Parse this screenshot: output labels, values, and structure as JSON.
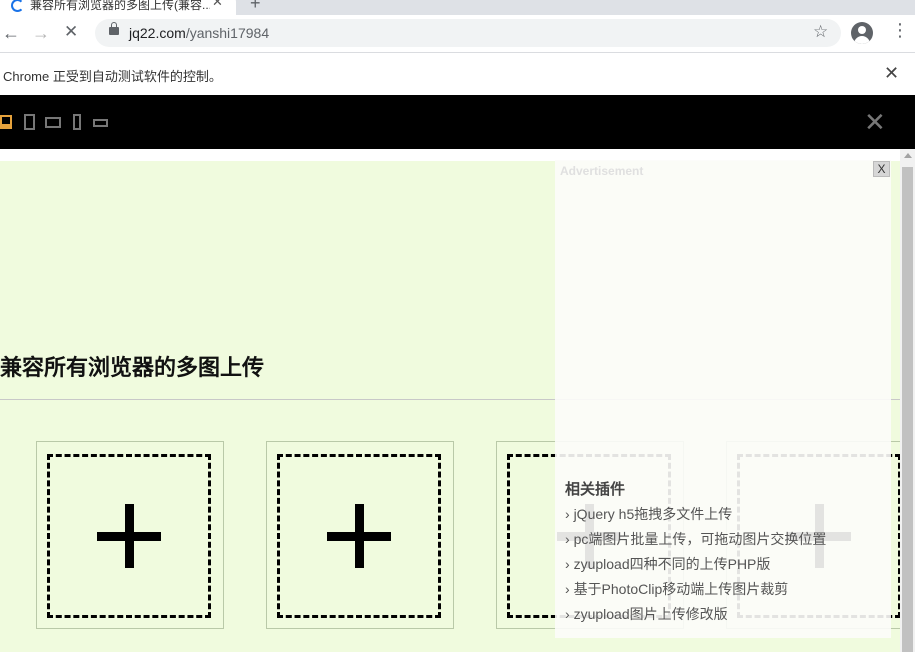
{
  "browser": {
    "tab_title": "兼容所有浏览器的多图上传(兼容...",
    "url_domain": "jq22.com",
    "url_path": "/yanshi17984",
    "infobar_text": "Chrome 正受到自动测试软件的控制。",
    "icons": {
      "back": "back-arrow-icon",
      "forward": "forward-arrow-icon",
      "stop": "close-icon",
      "star": "star-icon",
      "account": "account-icon",
      "menu": "more-vert-icon"
    }
  },
  "devbar": {
    "devices": [
      "desktop-icon",
      "tablet-portrait-icon",
      "tablet-landscape-icon",
      "phone-portrait-icon",
      "phone-landscape-icon"
    ],
    "close": "close-icon"
  },
  "page": {
    "heading": "兼容所有浏览器的多图上传",
    "upload_slots": 4,
    "background_color": "#f0fbde"
  },
  "ad": {
    "label": "Advertisement",
    "close_label": "X",
    "related_title": "相关插件",
    "related_items": [
      "jQuery h5拖拽多文件上传",
      "pc端图片批量上传，可拖动图片交换位置",
      "zyupload四种不同的上传PHP版",
      "基于PhotoClip移动端上传图片裁剪",
      "zyupload图片上传修改版"
    ]
  }
}
